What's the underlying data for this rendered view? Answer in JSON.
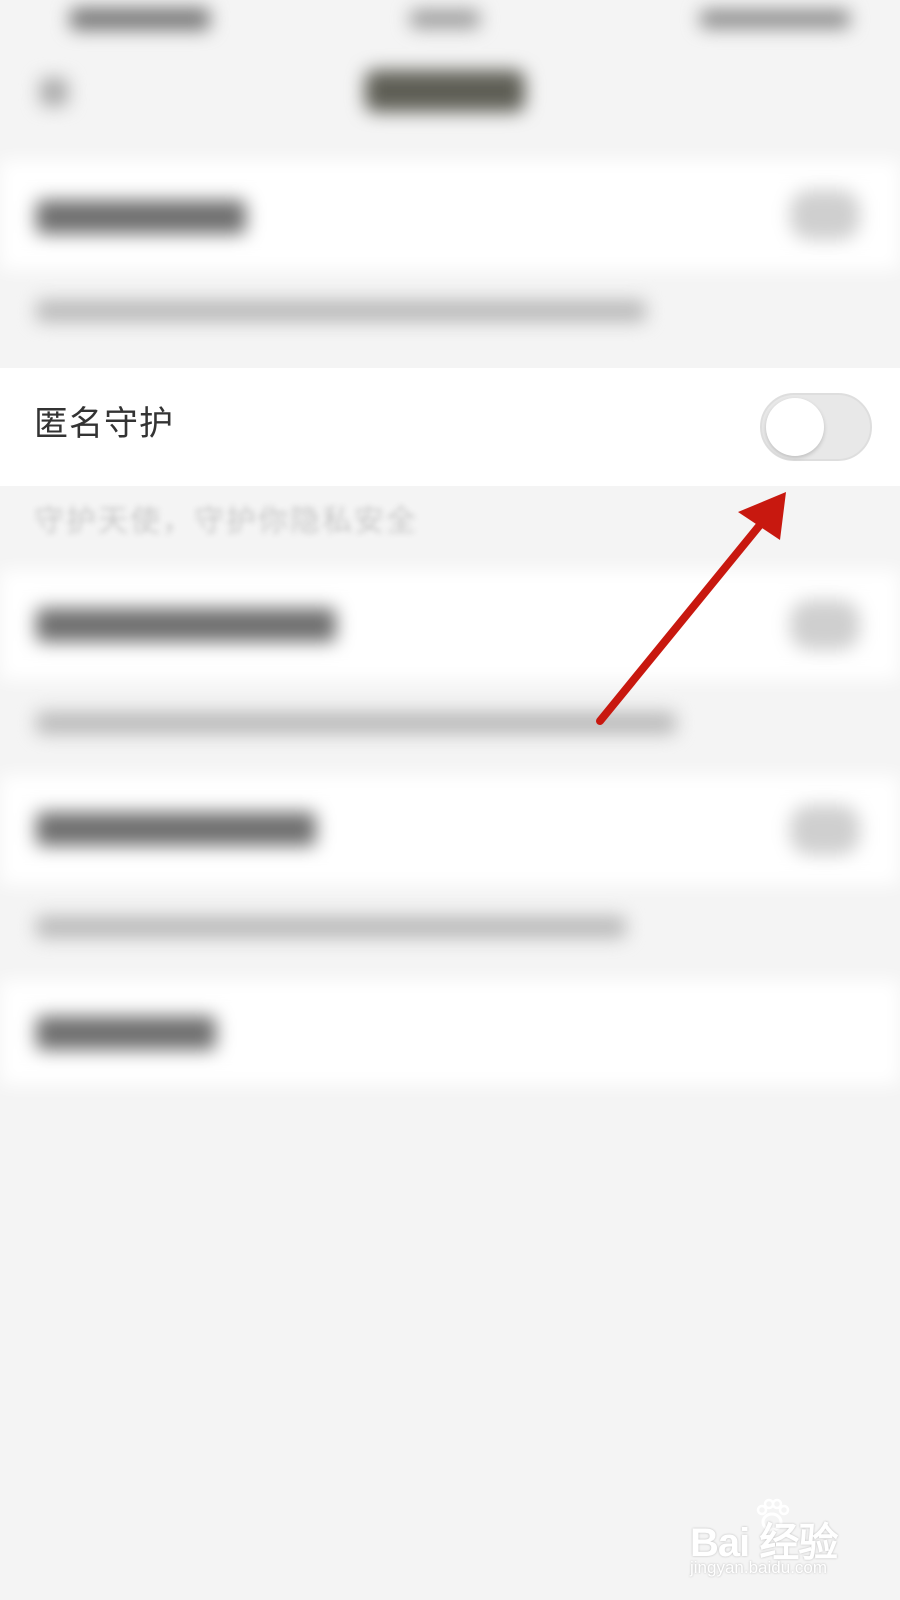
{
  "setting_row": {
    "label": "匿名守护",
    "toggle_on": false
  },
  "peek_caption": "守护天使，守护你隐私安全",
  "annotation": {
    "arrow_color": "#c8180f"
  },
  "watermark": {
    "logo_text": "Bai  经验",
    "url_text": "jingyan.baidu.com"
  }
}
